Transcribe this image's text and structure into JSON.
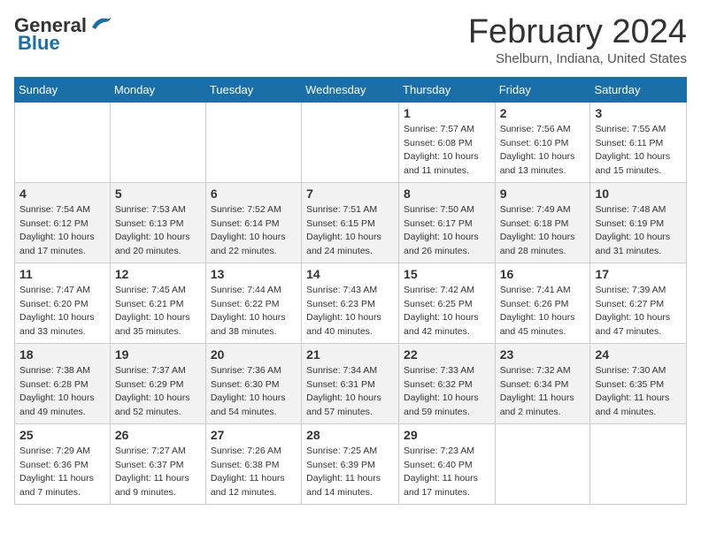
{
  "logo": {
    "line1": "General",
    "line2": "Blue"
  },
  "title": "February 2024",
  "location": "Shelburn, Indiana, United States",
  "days_header": [
    "Sunday",
    "Monday",
    "Tuesday",
    "Wednesday",
    "Thursday",
    "Friday",
    "Saturday"
  ],
  "weeks": [
    [
      {
        "num": "",
        "info": ""
      },
      {
        "num": "",
        "info": ""
      },
      {
        "num": "",
        "info": ""
      },
      {
        "num": "",
        "info": ""
      },
      {
        "num": "1",
        "info": "Sunrise: 7:57 AM\nSunset: 6:08 PM\nDaylight: 10 hours\nand 11 minutes."
      },
      {
        "num": "2",
        "info": "Sunrise: 7:56 AM\nSunset: 6:10 PM\nDaylight: 10 hours\nand 13 minutes."
      },
      {
        "num": "3",
        "info": "Sunrise: 7:55 AM\nSunset: 6:11 PM\nDaylight: 10 hours\nand 15 minutes."
      }
    ],
    [
      {
        "num": "4",
        "info": "Sunrise: 7:54 AM\nSunset: 6:12 PM\nDaylight: 10 hours\nand 17 minutes."
      },
      {
        "num": "5",
        "info": "Sunrise: 7:53 AM\nSunset: 6:13 PM\nDaylight: 10 hours\nand 20 minutes."
      },
      {
        "num": "6",
        "info": "Sunrise: 7:52 AM\nSunset: 6:14 PM\nDaylight: 10 hours\nand 22 minutes."
      },
      {
        "num": "7",
        "info": "Sunrise: 7:51 AM\nSunset: 6:15 PM\nDaylight: 10 hours\nand 24 minutes."
      },
      {
        "num": "8",
        "info": "Sunrise: 7:50 AM\nSunset: 6:17 PM\nDaylight: 10 hours\nand 26 minutes."
      },
      {
        "num": "9",
        "info": "Sunrise: 7:49 AM\nSunset: 6:18 PM\nDaylight: 10 hours\nand 28 minutes."
      },
      {
        "num": "10",
        "info": "Sunrise: 7:48 AM\nSunset: 6:19 PM\nDaylight: 10 hours\nand 31 minutes."
      }
    ],
    [
      {
        "num": "11",
        "info": "Sunrise: 7:47 AM\nSunset: 6:20 PM\nDaylight: 10 hours\nand 33 minutes."
      },
      {
        "num": "12",
        "info": "Sunrise: 7:45 AM\nSunset: 6:21 PM\nDaylight: 10 hours\nand 35 minutes."
      },
      {
        "num": "13",
        "info": "Sunrise: 7:44 AM\nSunset: 6:22 PM\nDaylight: 10 hours\nand 38 minutes."
      },
      {
        "num": "14",
        "info": "Sunrise: 7:43 AM\nSunset: 6:23 PM\nDaylight: 10 hours\nand 40 minutes."
      },
      {
        "num": "15",
        "info": "Sunrise: 7:42 AM\nSunset: 6:25 PM\nDaylight: 10 hours\nand 42 minutes."
      },
      {
        "num": "16",
        "info": "Sunrise: 7:41 AM\nSunset: 6:26 PM\nDaylight: 10 hours\nand 45 minutes."
      },
      {
        "num": "17",
        "info": "Sunrise: 7:39 AM\nSunset: 6:27 PM\nDaylight: 10 hours\nand 47 minutes."
      }
    ],
    [
      {
        "num": "18",
        "info": "Sunrise: 7:38 AM\nSunset: 6:28 PM\nDaylight: 10 hours\nand 49 minutes."
      },
      {
        "num": "19",
        "info": "Sunrise: 7:37 AM\nSunset: 6:29 PM\nDaylight: 10 hours\nand 52 minutes."
      },
      {
        "num": "20",
        "info": "Sunrise: 7:36 AM\nSunset: 6:30 PM\nDaylight: 10 hours\nand 54 minutes."
      },
      {
        "num": "21",
        "info": "Sunrise: 7:34 AM\nSunset: 6:31 PM\nDaylight: 10 hours\nand 57 minutes."
      },
      {
        "num": "22",
        "info": "Sunrise: 7:33 AM\nSunset: 6:32 PM\nDaylight: 10 hours\nand 59 minutes."
      },
      {
        "num": "23",
        "info": "Sunrise: 7:32 AM\nSunset: 6:34 PM\nDaylight: 11 hours\nand 2 minutes."
      },
      {
        "num": "24",
        "info": "Sunrise: 7:30 AM\nSunset: 6:35 PM\nDaylight: 11 hours\nand 4 minutes."
      }
    ],
    [
      {
        "num": "25",
        "info": "Sunrise: 7:29 AM\nSunset: 6:36 PM\nDaylight: 11 hours\nand 7 minutes."
      },
      {
        "num": "26",
        "info": "Sunrise: 7:27 AM\nSunset: 6:37 PM\nDaylight: 11 hours\nand 9 minutes."
      },
      {
        "num": "27",
        "info": "Sunrise: 7:26 AM\nSunset: 6:38 PM\nDaylight: 11 hours\nand 12 minutes."
      },
      {
        "num": "28",
        "info": "Sunrise: 7:25 AM\nSunset: 6:39 PM\nDaylight: 11 hours\nand 14 minutes."
      },
      {
        "num": "29",
        "info": "Sunrise: 7:23 AM\nSunset: 6:40 PM\nDaylight: 11 hours\nand 17 minutes."
      },
      {
        "num": "",
        "info": ""
      },
      {
        "num": "",
        "info": ""
      }
    ]
  ]
}
